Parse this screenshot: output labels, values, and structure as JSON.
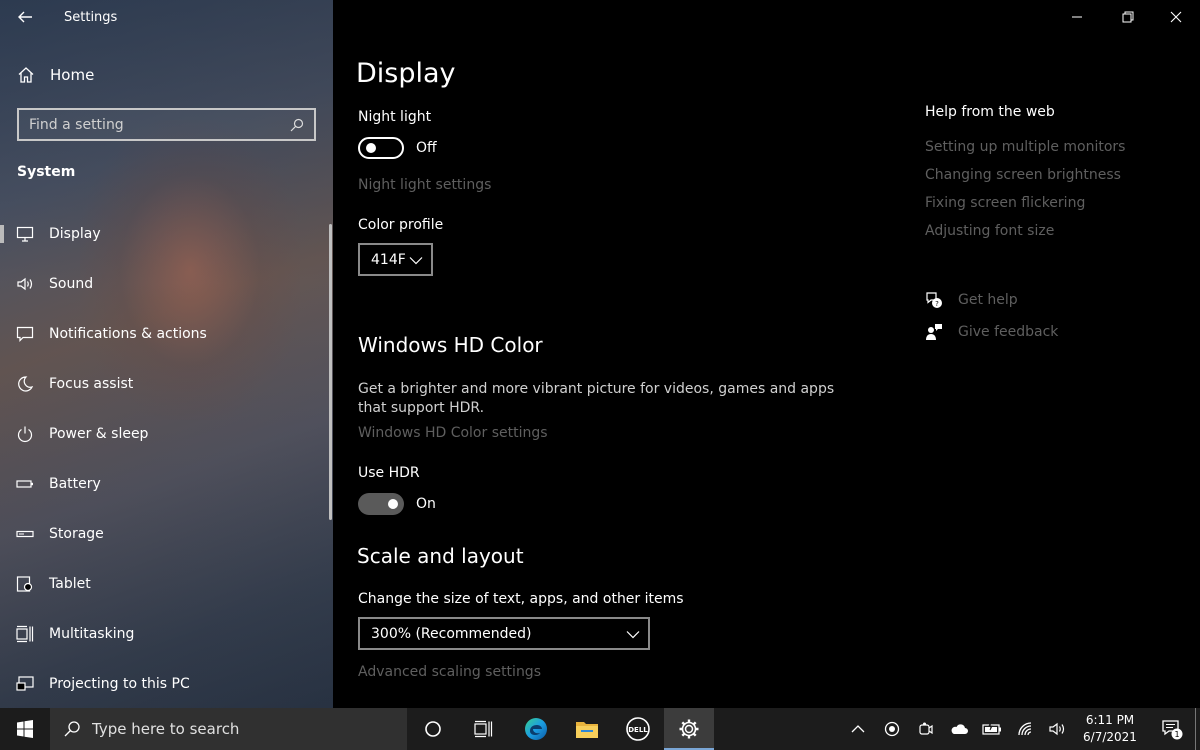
{
  "window": {
    "app_title": "Settings"
  },
  "sidebar": {
    "home_label": "Home",
    "search_placeholder": "Find a setting",
    "group_heading": "System",
    "items": [
      {
        "label": "Display",
        "icon": "monitor-icon",
        "active": true
      },
      {
        "label": "Sound",
        "icon": "speaker-icon"
      },
      {
        "label": "Notifications & actions",
        "icon": "message-icon"
      },
      {
        "label": "Focus assist",
        "icon": "moon-icon"
      },
      {
        "label": "Power & sleep",
        "icon": "power-icon"
      },
      {
        "label": "Battery",
        "icon": "battery-icon"
      },
      {
        "label": "Storage",
        "icon": "storage-icon"
      },
      {
        "label": "Tablet",
        "icon": "tablet-icon"
      },
      {
        "label": "Multitasking",
        "icon": "multitasking-icon"
      },
      {
        "label": "Projecting to this PC",
        "icon": "projecting-icon"
      }
    ]
  },
  "main": {
    "page_title": "Display",
    "night_light": {
      "label": "Night light",
      "state_text": "Off",
      "settings_link": "Night light settings"
    },
    "color_profile": {
      "label": "Color profile",
      "selected": "414F"
    },
    "hd_color": {
      "title": "Windows HD Color",
      "description": "Get a brighter and more vibrant picture for videos, games and apps that support HDR.",
      "settings_link": "Windows HD Color settings",
      "use_hdr_label": "Use HDR",
      "use_hdr_state": "On"
    },
    "scale_layout": {
      "title": "Scale and layout",
      "size_label": "Change the size of text, apps, and other items",
      "size_selected": "300% (Recommended)",
      "advanced_link": "Advanced scaling settings"
    }
  },
  "help": {
    "title": "Help from the web",
    "links": [
      "Setting up multiple monitors",
      "Changing screen brightness",
      "Fixing screen flickering",
      "Adjusting font size"
    ],
    "get_help": "Get help",
    "give_feedback": "Give feedback"
  },
  "taskbar": {
    "search_placeholder": "Type here to search",
    "time": "6:11 PM",
    "date": "6/7/2021",
    "notification_count": "1"
  },
  "colors": {
    "background": "#000000",
    "dim_link": "#5f5f5f",
    "taskbar": "#1c1c1c",
    "accent": "#7aa6d6"
  }
}
